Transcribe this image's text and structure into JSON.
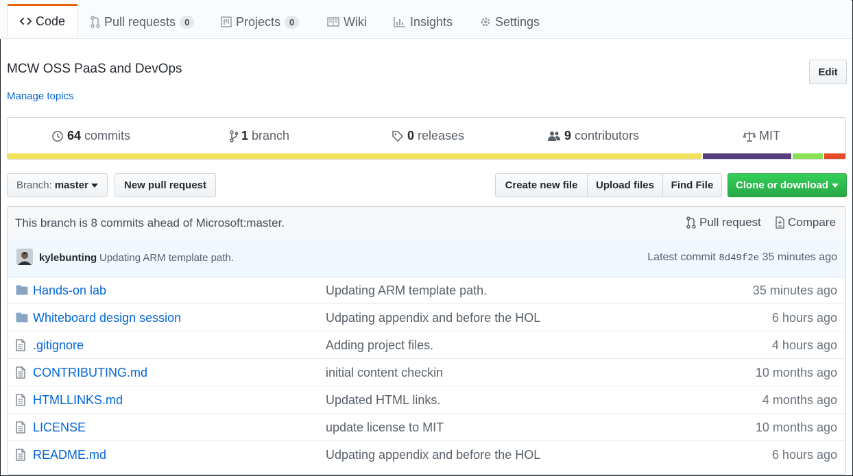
{
  "tabs": [
    {
      "label": "Code",
      "icon": "code-icon"
    },
    {
      "label": "Pull requests",
      "count": "0",
      "icon": "pull-request-icon"
    },
    {
      "label": "Projects",
      "count": "0",
      "icon": "project-icon"
    },
    {
      "label": "Wiki",
      "icon": "book-icon"
    },
    {
      "label": "Insights",
      "icon": "graph-icon"
    },
    {
      "label": "Settings",
      "icon": "gear-icon"
    }
  ],
  "repo": {
    "description": "MCW OSS PaaS and DevOps",
    "manage_topics": "Manage topics",
    "edit_label": "Edit"
  },
  "summary": {
    "commits_num": "64",
    "commits_label": "commits",
    "branch_num": "1",
    "branch_label": "branch",
    "releases_num": "0",
    "releases_label": "releases",
    "contributors_num": "9",
    "contributors_label": "contributors",
    "license": "MIT"
  },
  "languages": [
    {
      "color": "#f1e05a",
      "share": 0.828
    },
    {
      "color": "#563d7c",
      "share": 0.106
    },
    {
      "color": "#89e051",
      "share": 0.036
    },
    {
      "color": "#e34c26",
      "share": 0.025
    }
  ],
  "toolbar": {
    "branch_prefix": "Branch:",
    "branch_name": "master",
    "new_pr": "New pull request",
    "create_file": "Create new file",
    "upload_files": "Upload files",
    "find_file": "Find File",
    "clone": "Clone or download"
  },
  "ahead": {
    "text": "This branch is 8 commits ahead of Microsoft:master.",
    "pull_request": "Pull request",
    "compare": "Compare"
  },
  "latest_commit": {
    "author": "kylebunting",
    "message": "Updating ARM template path.",
    "prefix": "Latest commit",
    "sha": "8d49f2e",
    "age": "35 minutes ago"
  },
  "files": [
    {
      "type": "dir",
      "name": "Hands-on lab",
      "message": "Updating ARM template path.",
      "age": "35 minutes ago"
    },
    {
      "type": "dir",
      "name": "Whiteboard design session",
      "message": "Udpating appendix and before the HOL",
      "age": "6 hours ago"
    },
    {
      "type": "file",
      "name": ".gitignore",
      "message": "Adding project files.",
      "age": "4 hours ago"
    },
    {
      "type": "file",
      "name": "CONTRIBUTING.md",
      "message": "initial content checkin",
      "age": "10 months ago"
    },
    {
      "type": "file",
      "name": "HTMLLINKS.md",
      "message": "Updated HTML links.",
      "age": "4 months ago"
    },
    {
      "type": "file",
      "name": "LICENSE",
      "message": "update license to MIT",
      "age": "10 months ago"
    },
    {
      "type": "file",
      "name": "README.md",
      "message": "Udpating appendix and before the HOL",
      "age": "6 hours ago"
    }
  ],
  "colors": {
    "accent_tab": "#e36209",
    "link": "#0366d6",
    "clone_green": "#28a745"
  }
}
